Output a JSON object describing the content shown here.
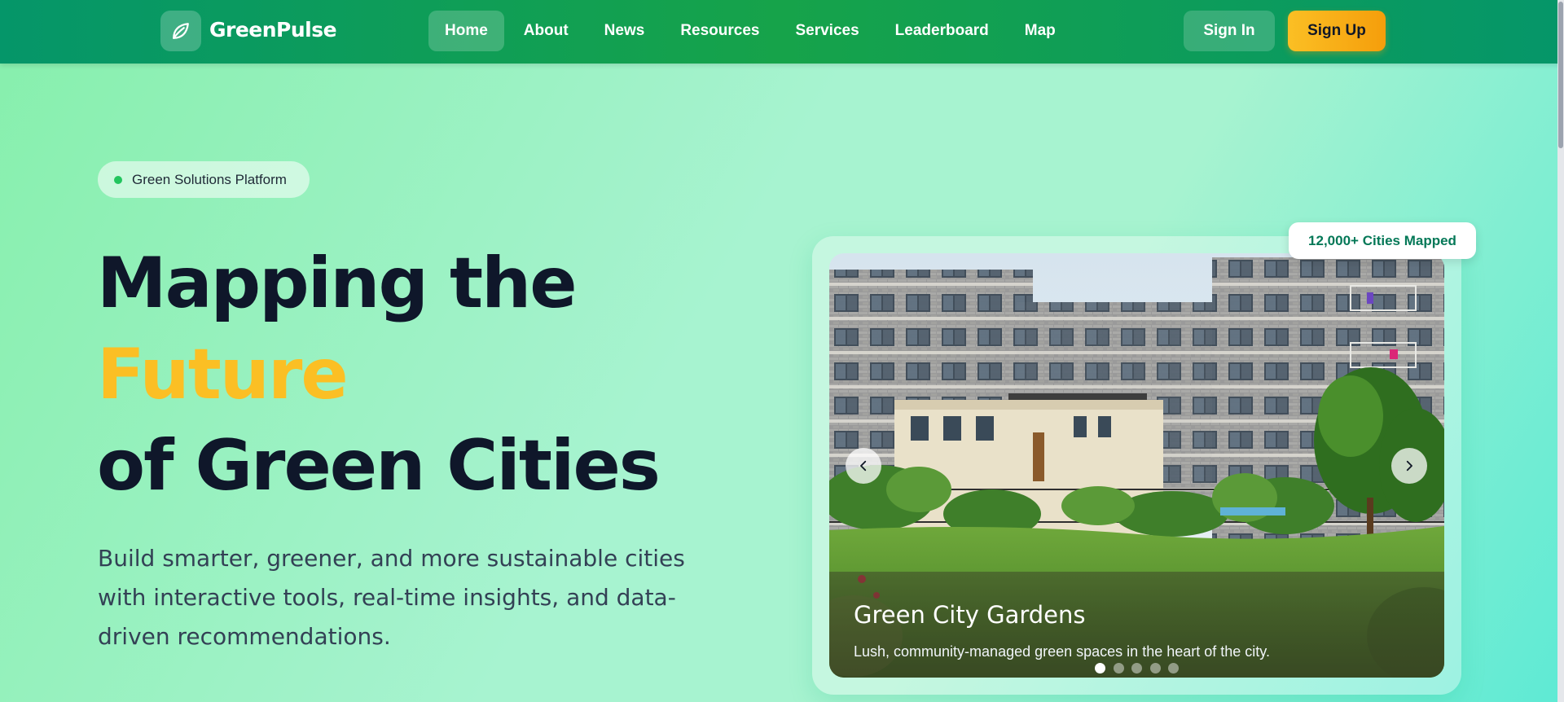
{
  "brand": {
    "name": "GreenPulse",
    "logo_icon": "leaf-icon"
  },
  "nav": {
    "links": [
      {
        "label": "Home",
        "active": true
      },
      {
        "label": "About"
      },
      {
        "label": "News"
      },
      {
        "label": "Resources"
      },
      {
        "label": "Services"
      },
      {
        "label": "Leaderboard"
      },
      {
        "label": "Map"
      }
    ],
    "sign_in": "Sign In",
    "sign_up": "Sign Up"
  },
  "hero": {
    "badge": "Green Solutions Platform",
    "title_line1": "Mapping the",
    "title_accent": "Future",
    "title_line3": "of Green Cities",
    "description": "Build smarter, greener, and more sustainable cities with interactive tools, real-time insights, and data-driven recommendations."
  },
  "carousel": {
    "stat_badge": "12,000+ Cities Mapped",
    "slide_title": "Green City Gardens",
    "slide_description": "Lush, community-managed green spaces in the heart of the city.",
    "slide_count": 5,
    "active_index": 0,
    "prev_icon": "chevron-left-icon",
    "next_icon": "chevron-right-icon"
  },
  "colors": {
    "nav_bg": "#059669",
    "accent_yellow": "#fbbf24",
    "heading_dark": "#0f172a",
    "stat_text": "#047857"
  }
}
